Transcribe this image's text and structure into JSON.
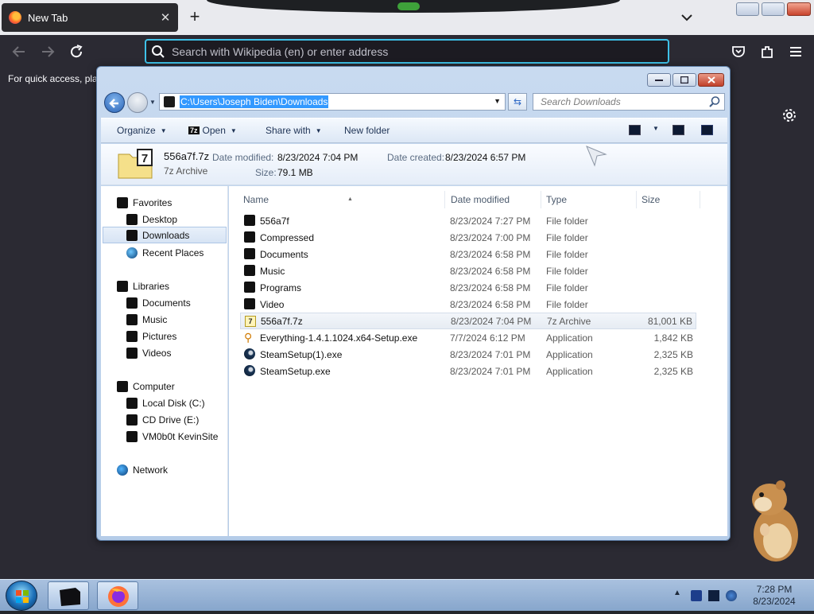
{
  "browser": {
    "tab_title": "New Tab",
    "url_placeholder": "Search with Wikipedia (en) or enter address",
    "bookmark_hint": "For quick access, pla"
  },
  "explorer": {
    "address_path": "C:\\Users\\Joseph Biden\\Downloads",
    "search_placeholder": "Search Downloads",
    "commands": {
      "organize": "Organize",
      "open": "Open",
      "open_badge": "7z",
      "share_with": "Share with",
      "new_folder": "New folder"
    },
    "details": {
      "name": "556a7f.7z",
      "type": "7z Archive",
      "date_modified_label": "Date modified:",
      "date_modified": "8/23/2024 7:04 PM",
      "date_created_label": "Date created:",
      "date_created": "8/23/2024 6:57 PM",
      "size_label": "Size:",
      "size": "79.1 MB"
    },
    "nav": {
      "favorites": "Favorites",
      "desktop": "Desktop",
      "downloads": "Downloads",
      "recent_places": "Recent Places",
      "libraries": "Libraries",
      "documents": "Documents",
      "music": "Music",
      "pictures": "Pictures",
      "videos": "Videos",
      "computer": "Computer",
      "local_disk": "Local Disk (C:)",
      "cd_drive": "CD Drive (E:)",
      "vm_share": "VM0b0t KevinSite",
      "network": "Network"
    },
    "columns": {
      "name": "Name",
      "date_modified": "Date modified",
      "type": "Type",
      "size": "Size"
    },
    "files": [
      {
        "name": "556a7f",
        "date": "8/23/2024 7:27 PM",
        "type": "File folder",
        "size": "",
        "icon": "folder-icon"
      },
      {
        "name": "Compressed",
        "date": "8/23/2024 7:00 PM",
        "type": "File folder",
        "size": "",
        "icon": "folder-icon"
      },
      {
        "name": "Documents",
        "date": "8/23/2024 6:58 PM",
        "type": "File folder",
        "size": "",
        "icon": "folder-icon"
      },
      {
        "name": "Music",
        "date": "8/23/2024 6:58 PM",
        "type": "File folder",
        "size": "",
        "icon": "folder-icon"
      },
      {
        "name": "Programs",
        "date": "8/23/2024 6:58 PM",
        "type": "File folder",
        "size": "",
        "icon": "folder-icon"
      },
      {
        "name": "Video",
        "date": "8/23/2024 6:58 PM",
        "type": "File folder",
        "size": "",
        "icon": "folder-icon"
      },
      {
        "name": "556a7f.7z",
        "date": "8/23/2024 7:04 PM",
        "type": "7z Archive",
        "size": "81,001 KB",
        "icon": "archive-icon"
      },
      {
        "name": "Everything-1.4.1.1024.x64-Setup.exe",
        "date": "7/7/2024 6:12 PM",
        "type": "Application",
        "size": "1,842 KB",
        "icon": "magnifier-app-icon"
      },
      {
        "name": "SteamSetup(1).exe",
        "date": "8/23/2024 7:01 PM",
        "type": "Application",
        "size": "2,325 KB",
        "icon": "steam-icon"
      },
      {
        "name": "SteamSetup.exe",
        "date": "8/23/2024 7:01 PM",
        "type": "Application",
        "size": "2,325 KB",
        "icon": "steam-icon"
      }
    ]
  },
  "taskbar": {
    "time": "7:28 PM",
    "date": "8/23/2024"
  },
  "colors": {
    "accent_focus": "#3ec1e8",
    "selection": "#3399ff",
    "firefox_toolbar": "#2b2a33"
  }
}
